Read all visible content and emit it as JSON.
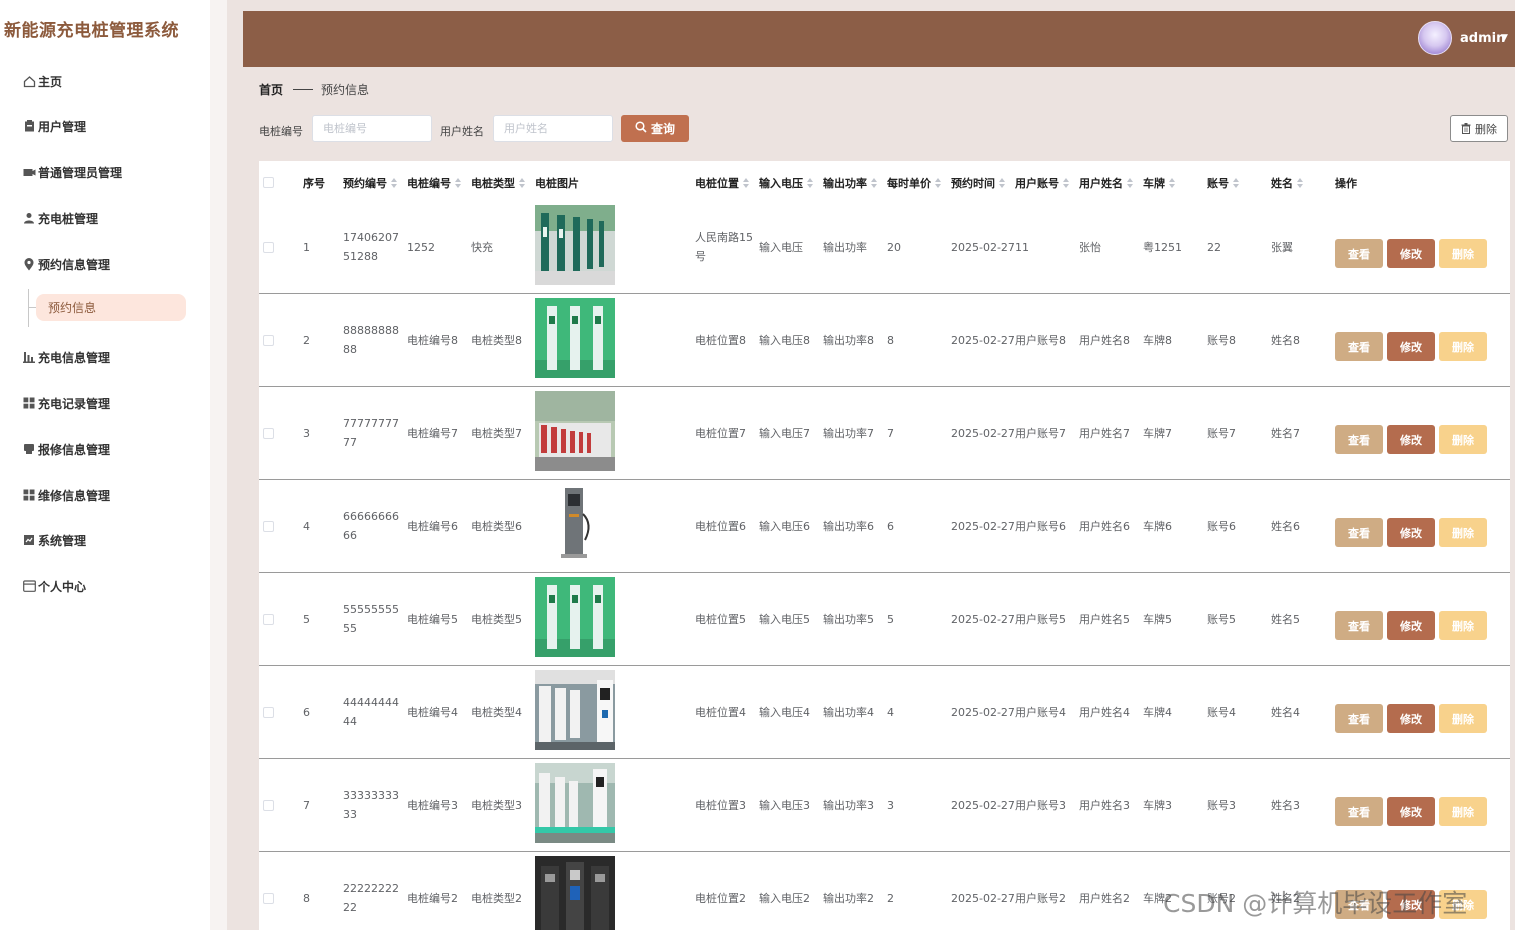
{
  "app": {
    "title": "新能源充电桩管理系统"
  },
  "sidebar": {
    "items": [
      {
        "label": "主页",
        "icon": "home-icon"
      },
      {
        "label": "用户管理",
        "icon": "clipboard-icon"
      },
      {
        "label": "普通管理员管理",
        "icon": "camera-icon"
      },
      {
        "label": "充电桩管理",
        "icon": "user-icon"
      },
      {
        "label": "预约信息管理",
        "icon": "pin-icon"
      },
      {
        "label": "充电信息管理",
        "icon": "chart-icon"
      },
      {
        "label": "充电记录管理",
        "icon": "grid-icon"
      },
      {
        "label": "报修信息管理",
        "icon": "folder-icon"
      },
      {
        "label": "维修信息管理",
        "icon": "grid-icon"
      },
      {
        "label": "系统管理",
        "icon": "doc-icon"
      },
      {
        "label": "个人中心",
        "icon": "calendar-icon"
      }
    ],
    "submenu": {
      "label": "预约信息"
    }
  },
  "header": {
    "username": "admin"
  },
  "breadcrumb": {
    "home": "首页",
    "current": "预约信息"
  },
  "search": {
    "pile_no_label": "电桩编号",
    "pile_no_placeholder": "电桩编号",
    "user_name_label": "用户姓名",
    "user_name_placeholder": "用户姓名",
    "query_label": "查询",
    "delete_label": "删除"
  },
  "table": {
    "columns": {
      "index": "序号",
      "order_no": "预约编号",
      "pile_no": "电桩编号",
      "pile_type": "电桩类型",
      "pile_img": "电桩图片",
      "location": "电桩位置",
      "voltage": "输入电压",
      "power": "输出功率",
      "price": "每时单价",
      "time": "预约时间",
      "account": "用户账号",
      "username": "用户姓名",
      "plate": "车牌",
      "acct": "账号",
      "name": "姓名",
      "ops": "操作"
    },
    "actions": {
      "view": "查看",
      "edit": "修改",
      "delete": "删除"
    },
    "rows": [
      {
        "index": "1",
        "order_no": "1740620751288",
        "pile_no": "1252",
        "pile_type": "快充",
        "location": "人民南路15号",
        "voltage": "输入电压",
        "power": "输出功率",
        "price": "20",
        "time": "2025-02-27",
        "account": "11",
        "username": "张怡",
        "plate": "粤1251",
        "acct": "22",
        "name": "张翼",
        "img": "row-stations"
      },
      {
        "index": "2",
        "order_no": "8888888888",
        "pile_no": "电桩编号8",
        "pile_type": "电桩类型8",
        "location": "电桩位置8",
        "voltage": "输入电压8",
        "power": "输出功率8",
        "price": "8",
        "time": "2025-02-27",
        "account": "用户账号8",
        "username": "用户姓名8",
        "plate": "车牌8",
        "acct": "账号8",
        "name": "姓名8",
        "img": "green-chargers"
      },
      {
        "index": "3",
        "order_no": "7777777777",
        "pile_no": "电桩编号7",
        "pile_type": "电桩类型7",
        "location": "电桩位置7",
        "voltage": "输入电压7",
        "power": "输出功率7",
        "price": "7",
        "time": "2025-02-27",
        "account": "用户账号7",
        "username": "用户姓名7",
        "plate": "车牌7",
        "acct": "账号7",
        "name": "姓名7",
        "img": "outdoor-row"
      },
      {
        "index": "4",
        "order_no": "6666666666",
        "pile_no": "电桩编号6",
        "pile_type": "电桩类型6",
        "location": "电桩位置6",
        "voltage": "输入电压6",
        "power": "输出功率6",
        "price": "6",
        "time": "2025-02-27",
        "account": "用户账号6",
        "username": "用户姓名6",
        "plate": "车牌6",
        "acct": "账号6",
        "name": "姓名6",
        "img": "single-charger"
      },
      {
        "index": "5",
        "order_no": "5555555555",
        "pile_no": "电桩编号5",
        "pile_type": "电桩类型5",
        "location": "电桩位置5",
        "voltage": "输入电压5",
        "power": "输出功率5",
        "price": "5",
        "time": "2025-02-27",
        "account": "用户账号5",
        "username": "用户姓名5",
        "plate": "车牌5",
        "acct": "账号5",
        "name": "姓名5",
        "img": "green-chargers"
      },
      {
        "index": "6",
        "order_no": "4444444444",
        "pile_no": "电桩编号4",
        "pile_type": "电桩类型4",
        "location": "电桩位置4",
        "voltage": "输入电压4",
        "power": "输出功率4",
        "price": "4",
        "time": "2025-02-27",
        "account": "用户账号4",
        "username": "用户姓名4",
        "plate": "车牌4",
        "acct": "账号4",
        "name": "姓名4",
        "img": "white-row"
      },
      {
        "index": "7",
        "order_no": "3333333333",
        "pile_no": "电桩编号3",
        "pile_type": "电桩类型3",
        "location": "电桩位置3",
        "voltage": "输入电压3",
        "power": "输出功率3",
        "price": "3",
        "time": "2025-02-27",
        "account": "用户账号3",
        "username": "用户姓名3",
        "plate": "车牌3",
        "acct": "账号3",
        "name": "姓名3",
        "img": "teal-row"
      },
      {
        "index": "8",
        "order_no": "2222222222",
        "pile_no": "电桩编号2",
        "pile_type": "电桩类型2",
        "location": "电桩位置2",
        "voltage": "输入电压2",
        "power": "输出功率2",
        "price": "2",
        "time": "2025-02-27",
        "account": "用户账号2",
        "username": "用户姓名2",
        "plate": "车牌2",
        "acct": "账号2",
        "name": "姓名2",
        "img": "dark-panels"
      }
    ]
  },
  "watermark": "CSDN @计算机毕设工作室",
  "colors": {
    "header": "#8c5e47",
    "accent": "#c0704f",
    "view": "#cfac84",
    "edit": "#b46c4e",
    "delete": "#f8d28c",
    "submenu_bg": "#fde6dd"
  }
}
